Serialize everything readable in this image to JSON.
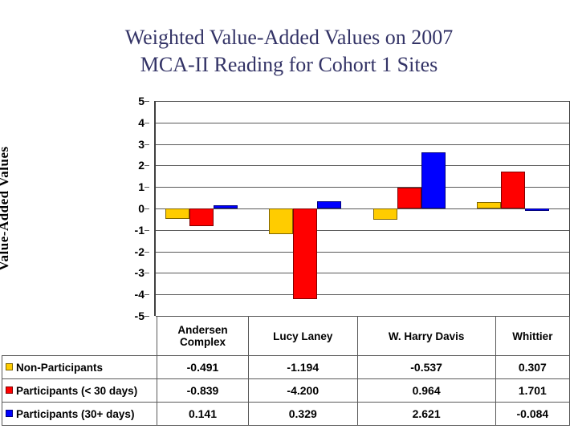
{
  "title": "Weighted Value-Added Values on 2007\nMCA-II Reading for Cohort 1 Sites",
  "colors": {
    "title": "#333366",
    "gridline": "#595959",
    "series_non_participants": "#FFCC00",
    "series_participants_lt30": "#FF0000",
    "series_participants_30plus": "#0000FF"
  },
  "chart_data": {
    "type": "bar",
    "title": "Weighted Value-Added Values on 2007 MCA-II Reading for Cohort 1 Sites",
    "xlabel": "",
    "ylabel": "Value-Added Values",
    "ylim": [
      -5,
      5
    ],
    "yticks": [
      5,
      4,
      3,
      2,
      1,
      0,
      -1,
      -2,
      -3,
      -4,
      -5
    ],
    "ytick_labels": [
      "5",
      "4",
      "3",
      "2",
      "1",
      "0",
      "-1",
      "-2",
      "-3",
      "-4",
      "-5"
    ],
    "grid": true,
    "legend_position": "table-left",
    "categories": [
      "Andersen\nComplex",
      "Lucy Laney",
      "W. Harry Davis",
      "Whittier"
    ],
    "series": [
      {
        "name": "Non-Participants",
        "color": "#FFCC00",
        "values": [
          -0.491,
          -1.194,
          -0.537,
          0.307
        ],
        "labels": [
          "-0.491",
          "-1.194",
          "-0.537",
          "0.307"
        ]
      },
      {
        "name": "Participants (< 30 days)",
        "color": "#FF0000",
        "values": [
          -0.839,
          -4.2,
          0.964,
          1.701
        ],
        "labels": [
          "-0.839",
          "-4.200",
          "0.964",
          "1.701"
        ]
      },
      {
        "name": "Participants (30+ days)",
        "color": "#0000FF",
        "values": [
          0.141,
          0.329,
          2.621,
          -0.084
        ],
        "labels": [
          "0.141",
          "0.329",
          "2.621",
          "-0.084"
        ]
      }
    ]
  }
}
